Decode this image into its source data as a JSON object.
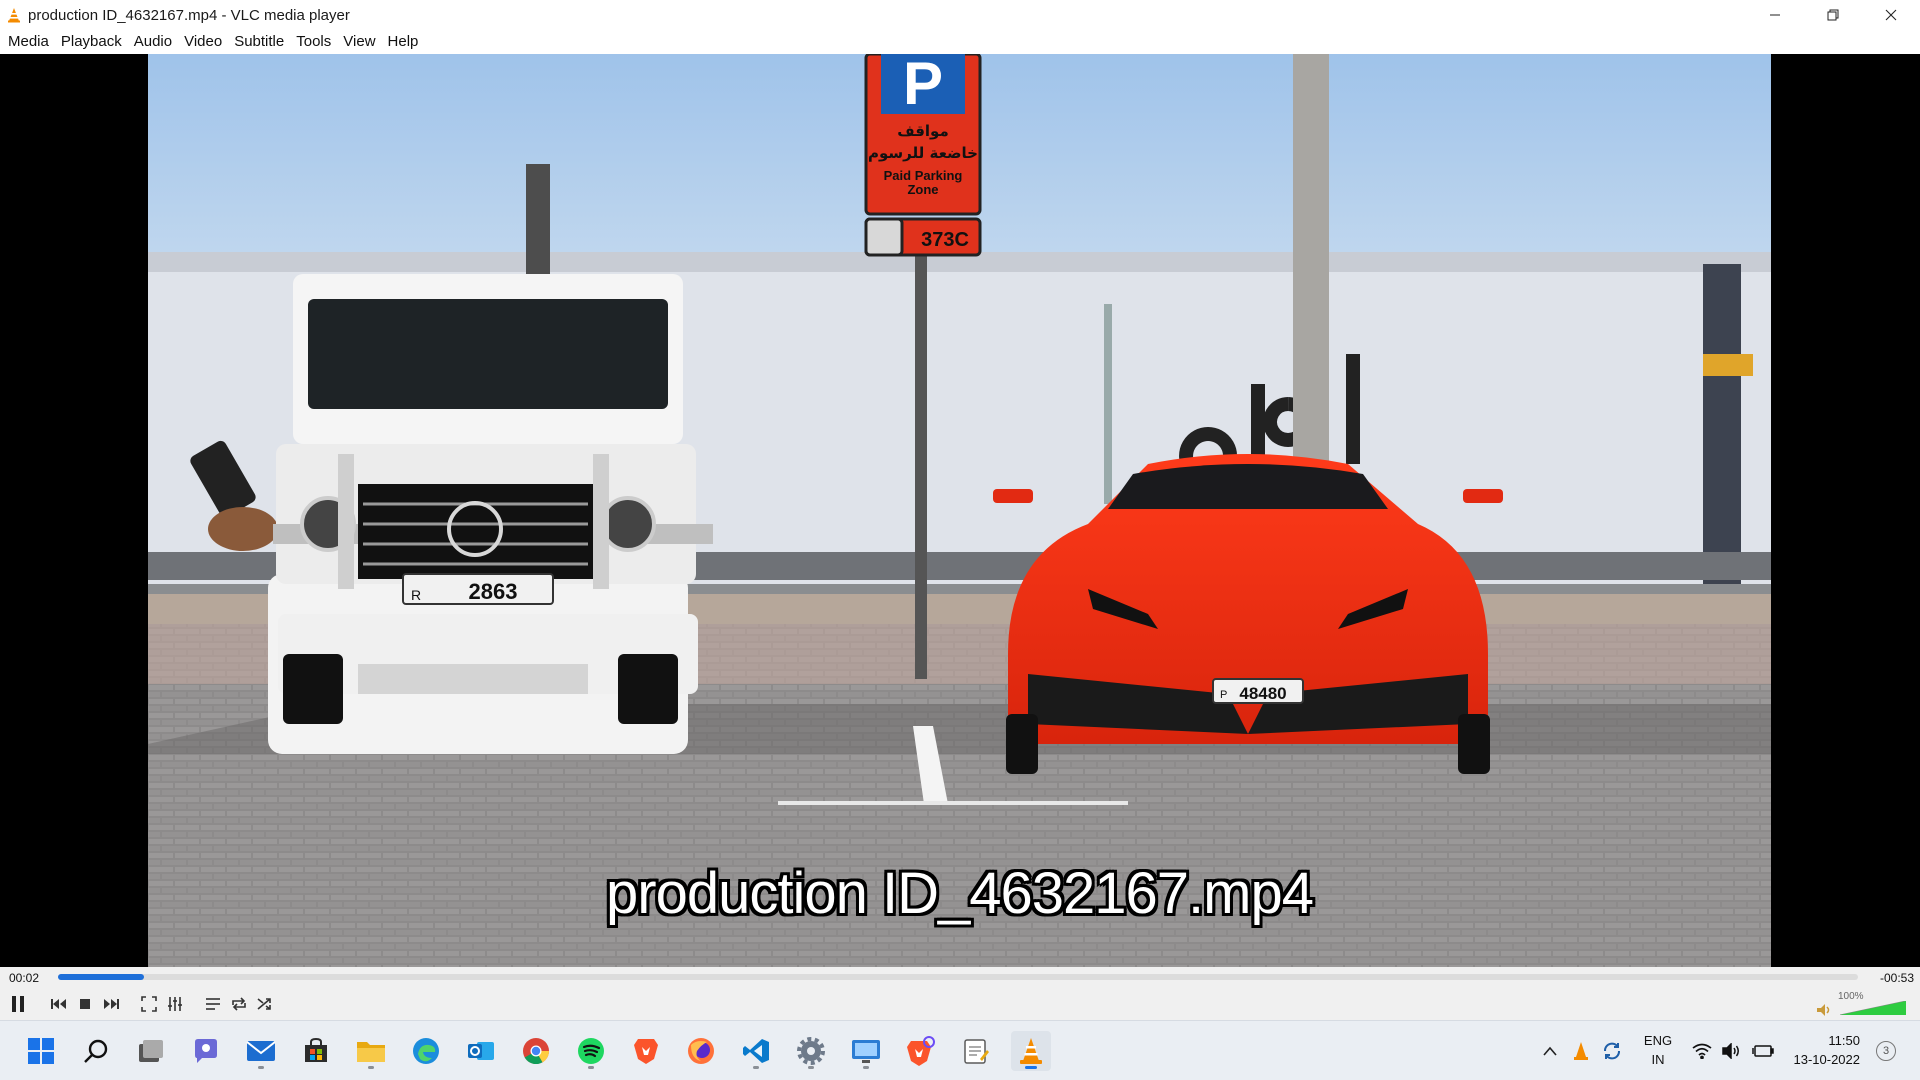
{
  "window": {
    "title": "production ID_4632167.mp4 - VLC media player",
    "app_icon": "vlc-cone-icon",
    "controls": [
      "minimize-icon",
      "restore-icon",
      "close-icon"
    ]
  },
  "menu": {
    "items": [
      "Media",
      "Playback",
      "Audio",
      "Video",
      "Subtitle",
      "Tools",
      "View",
      "Help"
    ]
  },
  "video": {
    "subtitle": "production ID_4632167.mp4",
    "sign": {
      "letter": "P",
      "arabic_line1": "مواقف",
      "arabic_line2": "خاضعة للرسوم",
      "english_line1": "Paid Parking",
      "english_line2": "Zone",
      "zone_code": "373C"
    },
    "plates": {
      "suv_letter": "R",
      "suv_number": "2863",
      "sports_letter": "P",
      "sports_number": "48480"
    }
  },
  "playback": {
    "elapsed": "00:02",
    "remaining": "-00:53",
    "progress_fraction": 0.048,
    "accent": "#1e6fd9"
  },
  "controls": {
    "buttons": [
      "pause-icon",
      "previous-icon",
      "stop-icon",
      "next-icon",
      "fullscreen-icon",
      "extended-settings-icon",
      "playlist-icon",
      "loop-icon",
      "shuffle-icon"
    ],
    "volume_label": "100%",
    "volume_fraction": 1.0,
    "volume_color": "#2ecc40"
  },
  "taskbar": {
    "apps": [
      "windows-start-icon",
      "search-icon",
      "task-view-icon",
      "teams-chat-icon",
      "mail-icon",
      "microsoft-store-icon",
      "file-explorer-icon",
      "edge-icon",
      "outlook-icon",
      "chrome-icon",
      "spotify-icon",
      "brave-icon",
      "firefox-icon",
      "vscode-icon",
      "settings-icon",
      "remote-desktop-icon",
      "brave-nightly-icon",
      "notepad-icon",
      "vlc-icon"
    ],
    "tray_icons": [
      "chevron-up-icon",
      "vlc-tray-icon",
      "sync-icon",
      "wifi-icon",
      "speaker-icon",
      "battery-icon"
    ],
    "language_line1": "ENG",
    "language_line2": "IN",
    "time": "11:50",
    "date": "13-10-2022",
    "notification_count": "3"
  }
}
